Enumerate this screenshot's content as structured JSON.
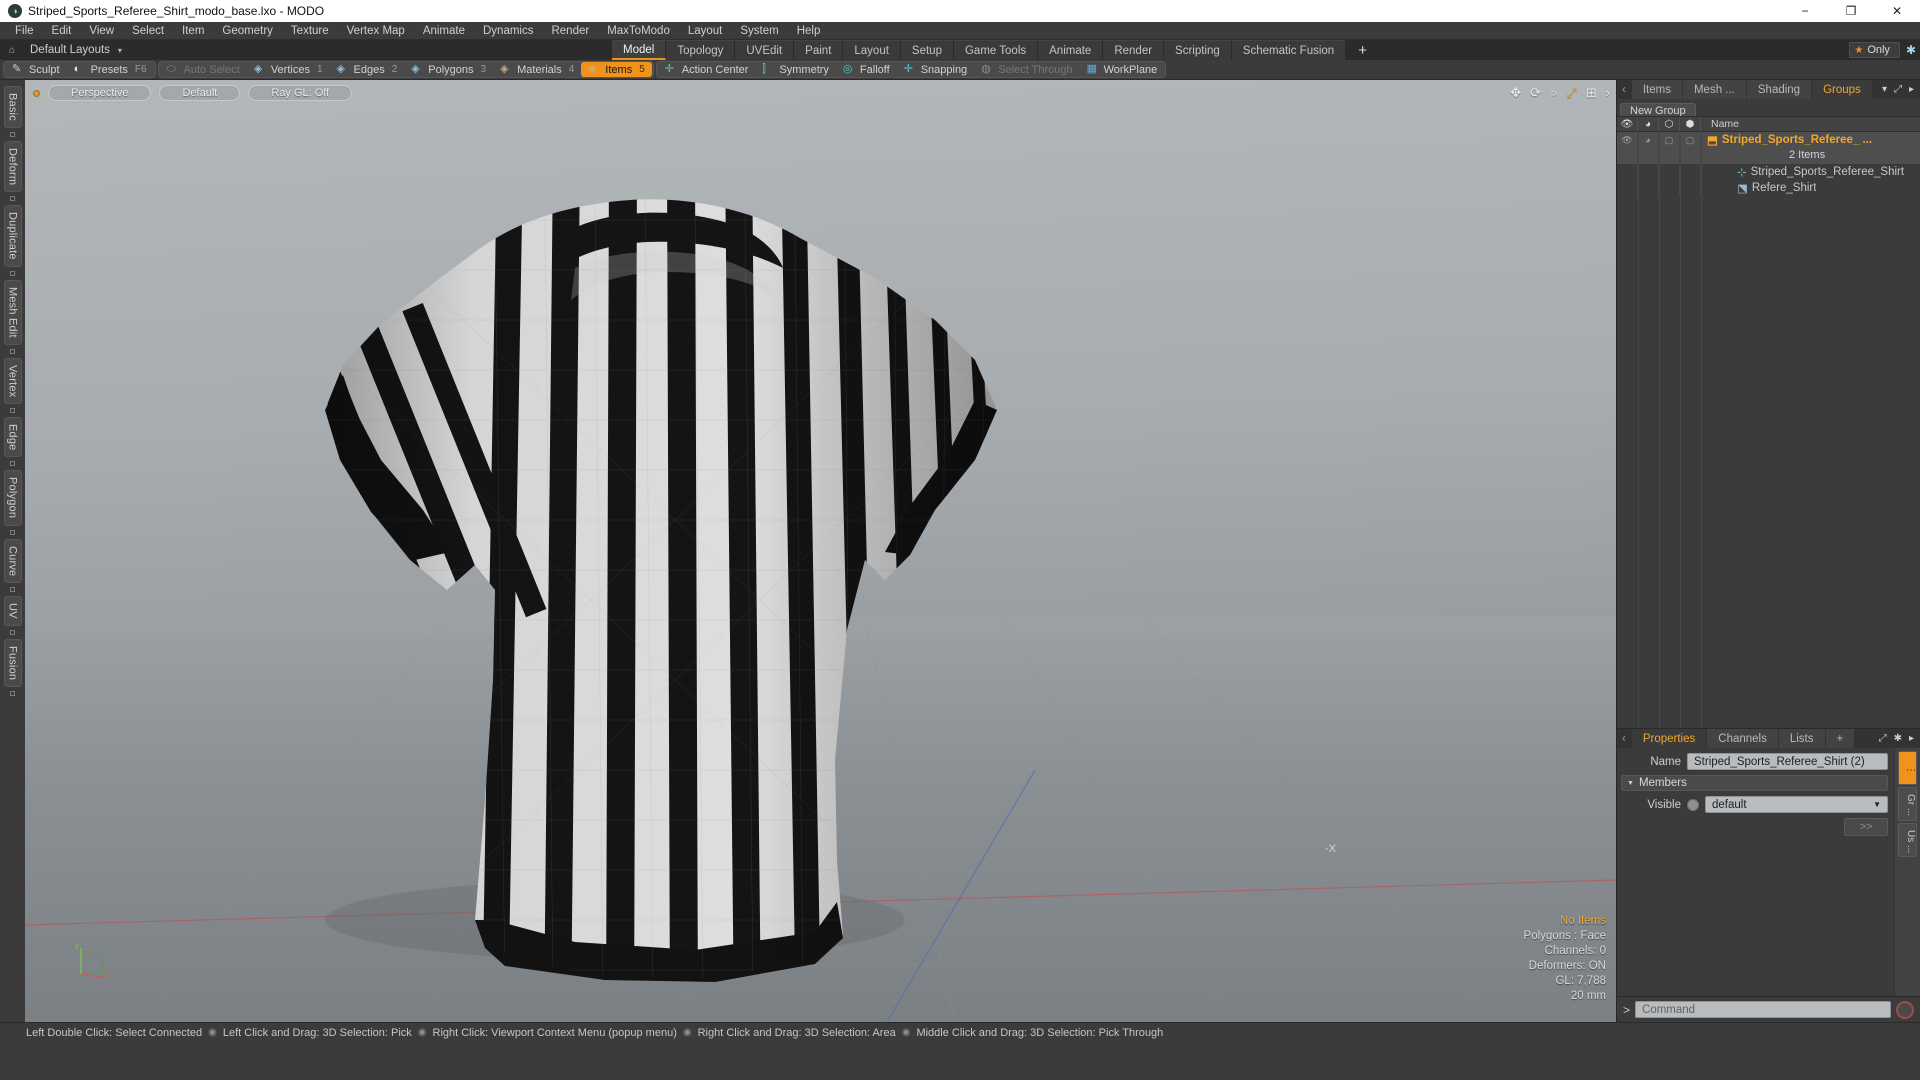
{
  "window": {
    "title": "Striped_Sports_Referee_Shirt_modo_base.lxo - MODO",
    "logo": "modo-logo-icon",
    "minimize": "−",
    "maximize": "❐",
    "close": "✕"
  },
  "menubar": {
    "items": [
      "File",
      "Edit",
      "View",
      "Select",
      "Item",
      "Geometry",
      "Texture",
      "Vertex Map",
      "Animate",
      "Dynamics",
      "Render",
      "MaxToModo",
      "Layout",
      "System",
      "Help"
    ]
  },
  "layoutbar": {
    "home_icon": "home-icon",
    "label": "Default Layouts",
    "caret": "▾",
    "tabs": [
      {
        "label": "Model",
        "active": true
      },
      {
        "label": "Topology",
        "active": false
      },
      {
        "label": "UVEdit",
        "active": false
      },
      {
        "label": "Paint",
        "active": false
      },
      {
        "label": "Layout",
        "active": false
      },
      {
        "label": "Setup",
        "active": false
      },
      {
        "label": "Game Tools",
        "active": false
      },
      {
        "label": "Animate",
        "active": false
      },
      {
        "label": "Render",
        "active": false
      },
      {
        "label": "Scripting",
        "active": false
      },
      {
        "label": "Schematic Fusion",
        "active": false
      }
    ],
    "add_tab": "+",
    "only_button": {
      "star": "★",
      "label": "Only"
    },
    "settings_icon": "gear-icon"
  },
  "modebar": {
    "group1": [
      {
        "label": "Sculpt",
        "icon": "sculpt-icon",
        "state": "normal",
        "num": ""
      },
      {
        "label": "Presets",
        "icon": "presets-sphere-icon",
        "state": "normal",
        "num": "F6"
      }
    ],
    "group2": [
      {
        "label": "Auto Select",
        "icon": "cylinder-icon",
        "state": "dim",
        "num": ""
      },
      {
        "label": "Vertices",
        "icon": "vertex-box-icon",
        "state": "normal",
        "num": "1"
      },
      {
        "label": "Edges",
        "icon": "edge-box-icon",
        "state": "normal",
        "num": "2"
      },
      {
        "label": "Polygons",
        "icon": "polygon-box-icon",
        "state": "normal",
        "num": "3"
      },
      {
        "label": "Materials",
        "icon": "material-box-icon",
        "state": "normal",
        "num": "4"
      },
      {
        "label": "Items",
        "icon": "item-box-icon",
        "state": "active",
        "num": "5"
      }
    ],
    "group3": [
      {
        "label": "Action Center",
        "icon": "action-center-icon",
        "state": "normal",
        "num": ""
      },
      {
        "label": "Symmetry",
        "icon": "symmetry-icon",
        "state": "normal",
        "num": ""
      },
      {
        "label": "Falloff",
        "icon": "falloff-icon",
        "state": "normal",
        "num": ""
      },
      {
        "label": "Snapping",
        "icon": "snapping-icon",
        "state": "normal",
        "num": ""
      },
      {
        "label": "Select Through",
        "icon": "select-through-icon",
        "state": "dim",
        "num": ""
      },
      {
        "label": "WorkPlane",
        "icon": "workplane-icon",
        "state": "normal",
        "num": ""
      }
    ]
  },
  "left_tabs": [
    "Basic",
    "Deform",
    "Duplicate",
    "Mesh Edit",
    "Vertex",
    "Edge",
    "Polygon",
    "Curve",
    "UV",
    "Fusion"
  ],
  "viewport": {
    "dot": "viewport-active-dot",
    "pills": [
      "Perspective",
      "Default",
      "Ray GL: Off"
    ],
    "icons": [
      "move-icon",
      "rotate-icon",
      "zoom-icon",
      "fit-icon",
      "options-icon",
      "expand-icon"
    ],
    "stats": {
      "selection": "No Items",
      "polygons": "Polygons : Face",
      "channels": "Channels: 0",
      "deformers": "Deformers: ON",
      "gl": "GL: 7,788",
      "grid": "20 mm"
    },
    "axis_labels": {
      "y": "y",
      "x": "x",
      "neg_x": "-X"
    }
  },
  "right_dock": {
    "tabs": [
      {
        "label": "Items",
        "active": false
      },
      {
        "label": "Mesh ...",
        "active": false
      },
      {
        "label": "Shading",
        "active": false
      },
      {
        "label": "Groups",
        "active": true
      }
    ],
    "tab_caret": "▾",
    "tab_expand": "⤢",
    "tab_more": "▸",
    "new_group_button": "New Group",
    "tree_columns": [
      "eye-icon",
      "render-icon",
      "wire-icon",
      "shade-icon",
      "Name"
    ],
    "tree_rows": [
      {
        "name": "Striped_Sports_Referee_ ...",
        "icon": "group-icon",
        "type": "group",
        "selected": true,
        "sub": "2 Items"
      },
      {
        "name": "Striped_Sports_Referee_Shirt",
        "icon": "locator-icon",
        "type": "item",
        "selected": false
      },
      {
        "name": "Refere_Shirt",
        "icon": "mesh-icon",
        "type": "item",
        "selected": false
      }
    ]
  },
  "properties": {
    "tabs": [
      {
        "label": "Properties",
        "active": true
      },
      {
        "label": "Channels",
        "active": false
      },
      {
        "label": "Lists",
        "active": false
      },
      {
        "label": "+",
        "active": false
      }
    ],
    "expand_icon": "expand-icon",
    "gear_icon": "gear-icon",
    "more_icon": "▸",
    "name_label": "Name",
    "name_value": "Striped_Sports_Referee_Shirt (2)",
    "section_title": "Members",
    "section_tri": "▼",
    "visible_label": "Visible",
    "visible_value": "default",
    "visible_caret": "▼",
    "goto_button": ">>",
    "rail": [
      "⋮",
      "Gr ...",
      "Us ..."
    ]
  },
  "command_bar": {
    "prompt": ">",
    "placeholder": "Command",
    "record_icon": "record-icon"
  },
  "statusbar": {
    "hints": [
      "Left Double Click: Select Connected",
      "Left Click and Drag: 3D Selection: Pick",
      "Right Click: Viewport Context Menu (popup menu)",
      "Right Click and Drag: 3D Selection: Area",
      "Middle Click and Drag: 3D Selection: Pick Through"
    ],
    "separator": "◉"
  },
  "colors": {
    "accent": "#f0931e",
    "panel": "#3b3b3b",
    "viewport_top": "#b3b7ba",
    "viewport_bottom": "#81868a"
  }
}
